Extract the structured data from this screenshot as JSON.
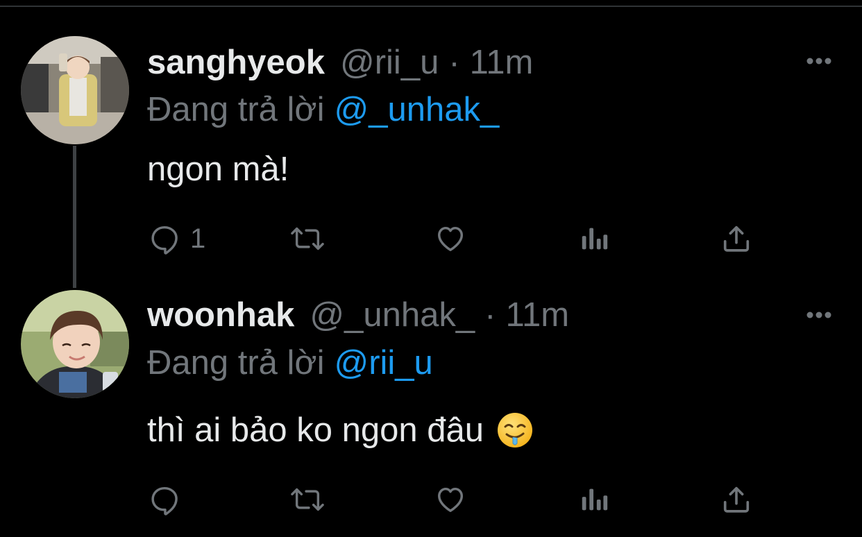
{
  "colors": {
    "background": "#000000",
    "text_primary": "#e7e9ea",
    "text_secondary": "#71767b",
    "link": "#1d9bf0",
    "thread_line": "#3e4144"
  },
  "tweets": [
    {
      "display_name": "sanghyeok",
      "handle": "@rii_u",
      "separator": "·",
      "time": "11m",
      "reply_prefix": "Đang trả lời",
      "reply_to": "@_unhak_",
      "text": "ngon mà!",
      "emoji": "",
      "avatar_icon": "profile-photo",
      "actions": {
        "reply_count": "1",
        "retweet_count": "",
        "like_count": "",
        "views_count": ""
      }
    },
    {
      "display_name": "woonhak",
      "handle": "@_unhak_",
      "separator": "·",
      "time": "11m",
      "reply_prefix": "Đang trả lời",
      "reply_to": "@rii_u",
      "text": "thì ai bảo ko ngon đâu",
      "emoji": "drooling-face",
      "avatar_icon": "profile-photo",
      "actions": {
        "reply_count": "",
        "retweet_count": "",
        "like_count": "",
        "views_count": ""
      }
    }
  ],
  "icons": {
    "more": "more-dots-icon",
    "reply": "reply-icon",
    "retweet": "retweet-icon",
    "like": "heart-icon",
    "views": "views-chart-icon",
    "share": "share-icon"
  }
}
